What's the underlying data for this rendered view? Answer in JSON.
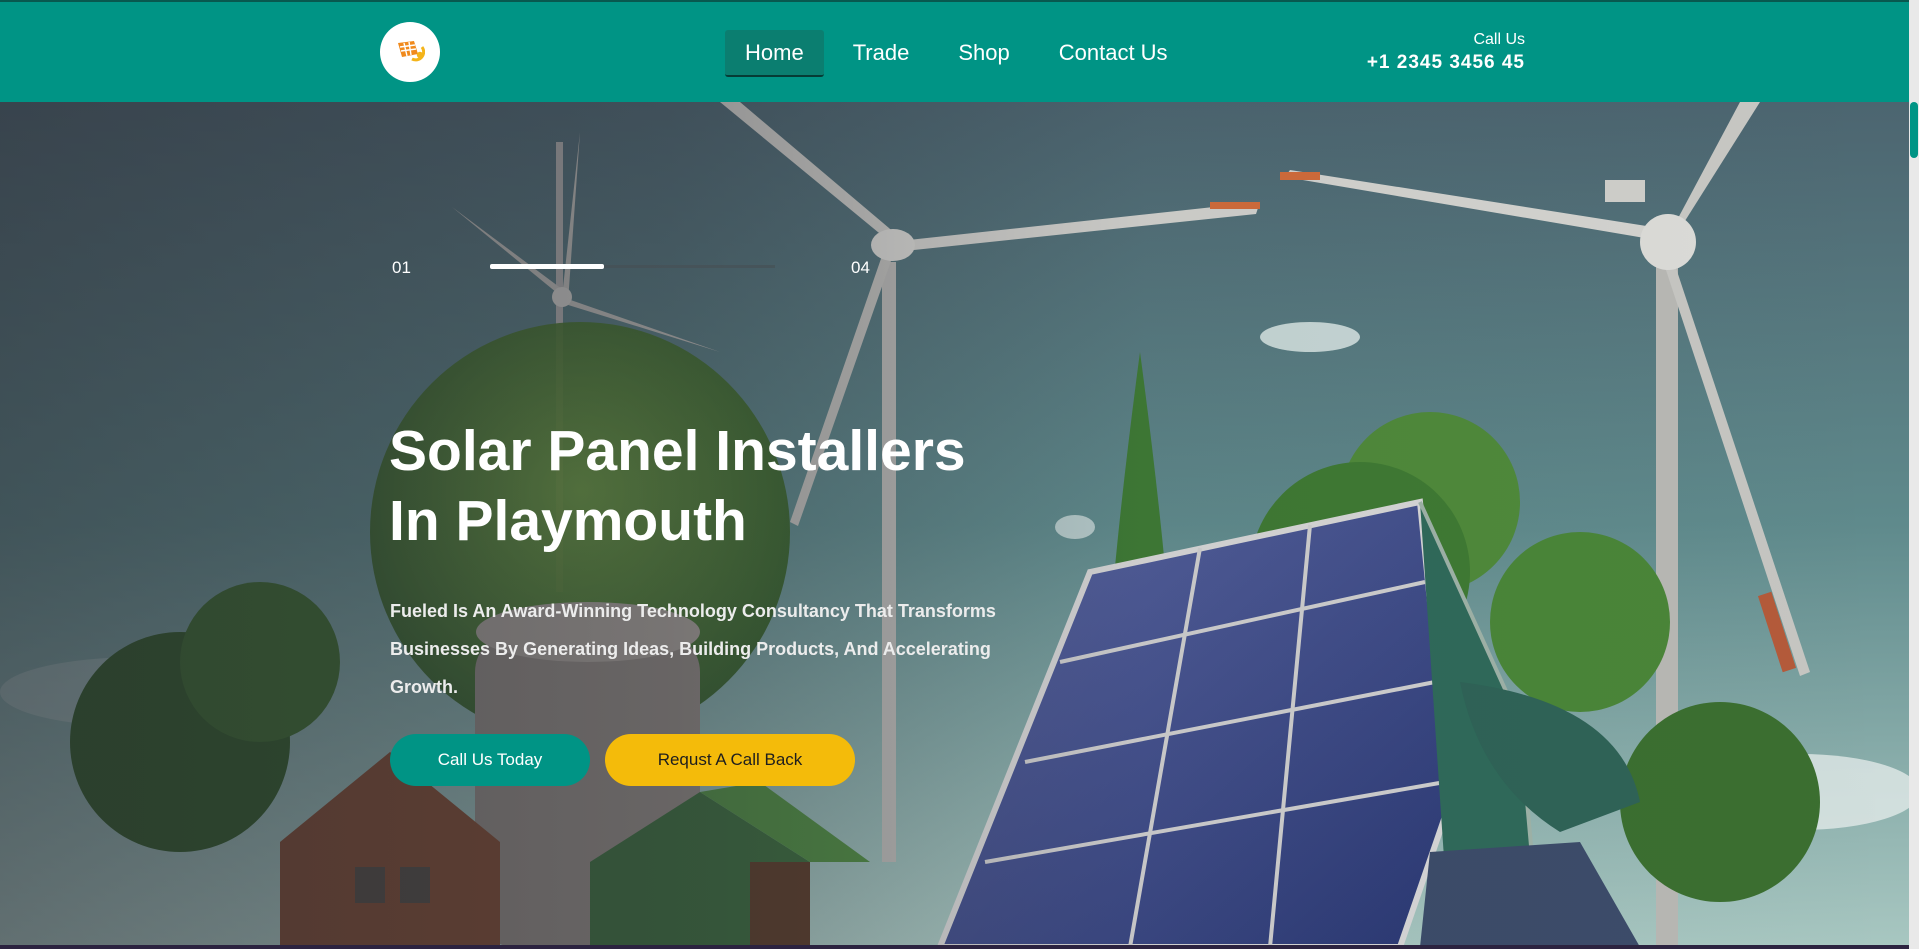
{
  "header": {
    "logo_icon": "solar-sun-logo-icon",
    "nav": [
      {
        "label": "Home",
        "active": true
      },
      {
        "label": "Trade",
        "active": false
      },
      {
        "label": "Shop",
        "active": false
      },
      {
        "label": "Contact Us",
        "active": false
      }
    ],
    "call_label": "Call Us",
    "phone": "+1 2345 3456 45"
  },
  "hero": {
    "slider": {
      "start": "01",
      "end": "04",
      "progress": 0.4
    },
    "title_line1": "Solar Panel Installers",
    "title_line2": "In Playmouth",
    "description": "Fueled Is An Award-Winning Technology Consultancy That Transforms Businesses By Generating Ideas, Building Products, And Accelerating Growth.",
    "primary_button": "Call Us Today",
    "secondary_button": "Requst A Call Back"
  },
  "colors": {
    "brand": "#009485",
    "accent": "#f4bb0a",
    "text_light": "#ffffff"
  }
}
